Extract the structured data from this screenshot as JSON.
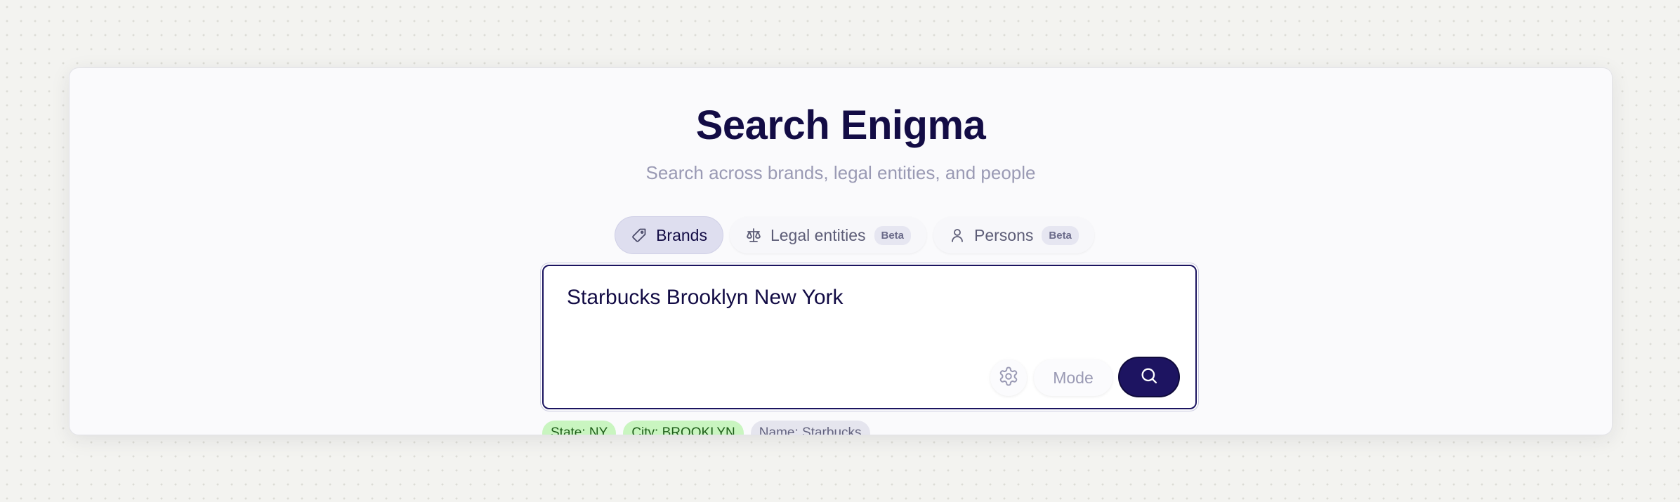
{
  "page": {
    "title": "Search Enigma",
    "subtitle": "Search across brands, legal entities, and people"
  },
  "tabs": [
    {
      "label": "Brands",
      "icon": "tag-icon",
      "active": true
    },
    {
      "label": "Legal entities",
      "icon": "scale-icon",
      "badge": "Beta"
    },
    {
      "label": "Persons",
      "icon": "person-icon",
      "badge": "Beta"
    }
  ],
  "search": {
    "value": "Starbucks Brooklyn New York",
    "mode_label": "Mode"
  },
  "filters": [
    {
      "label": "State: NY"
    },
    {
      "label": "City: BROOKLYN"
    },
    {
      "label": "Name: Starbucks"
    }
  ],
  "colors": {
    "brand_dark": "#130c45",
    "submit_bg": "#1d1461",
    "active_tab_bg": "#dedeef",
    "chip_green_bg": "#c9f5c0",
    "chip_grey_bg": "#e5e5ee"
  }
}
